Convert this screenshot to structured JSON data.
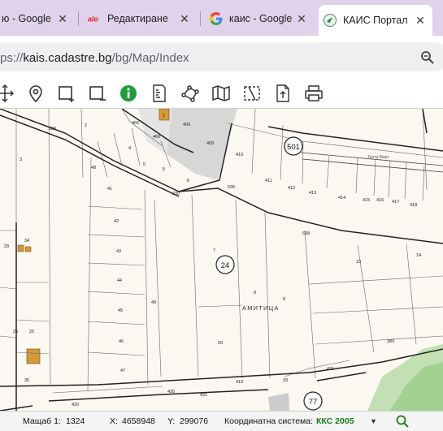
{
  "browser": {
    "tabs": [
      {
        "title": "ю - Google",
        "icon": "google-icon",
        "active": false
      },
      {
        "title": "Редактиране",
        "icon": "alo-icon",
        "active": false
      },
      {
        "title": "каис - Google",
        "icon": "google-icon",
        "active": false
      },
      {
        "title": "КАИС Портал",
        "icon": "kais-icon",
        "active": true
      }
    ],
    "address": {
      "prefix": "ps://",
      "host": "kais.cadastre.bg",
      "path": "/bg/Map/Index"
    }
  },
  "toolbar": {
    "tools": [
      "pan-icon",
      "location-pin-icon",
      "add-rectangle-icon",
      "remove-rectangle-icon",
      "info-icon",
      "document-ruler-icon",
      "polygon-measure-icon",
      "map-icon",
      "split-parcel-icon",
      "export-document-icon",
      "print-icon"
    ]
  },
  "map": {
    "parcel_labels": [
      "226",
      "2",
      "466",
      "466",
      "406",
      "409",
      "410",
      "411",
      "412",
      "413",
      "414",
      "415",
      "416",
      "417",
      "418",
      "1",
      "3",
      "4",
      "5",
      "5",
      "6",
      "48",
      "41",
      "42",
      "43",
      "44",
      "45",
      "46",
      "47",
      "230",
      "635",
      "638",
      "10",
      "14",
      "7",
      "8",
      "9",
      "20",
      "29",
      "34",
      "26",
      "25",
      "49",
      "419",
      "420",
      "421",
      "389",
      "431",
      "430",
      "33",
      "35"
    ],
    "block_numbers": [
      "501",
      "24",
      "77"
    ],
    "street_labels": [
      "Трети Март",
      "АМИТИЦА"
    ]
  },
  "status": {
    "scale_label": "Мащаб 1:",
    "scale_value": "1324",
    "x_label": "X:",
    "x_value": "4658948",
    "y_label": "Y:",
    "y_value": "299076",
    "cs_label": "Координатна система:",
    "cs_value": "ККС 2005",
    "caret": "▼"
  }
}
